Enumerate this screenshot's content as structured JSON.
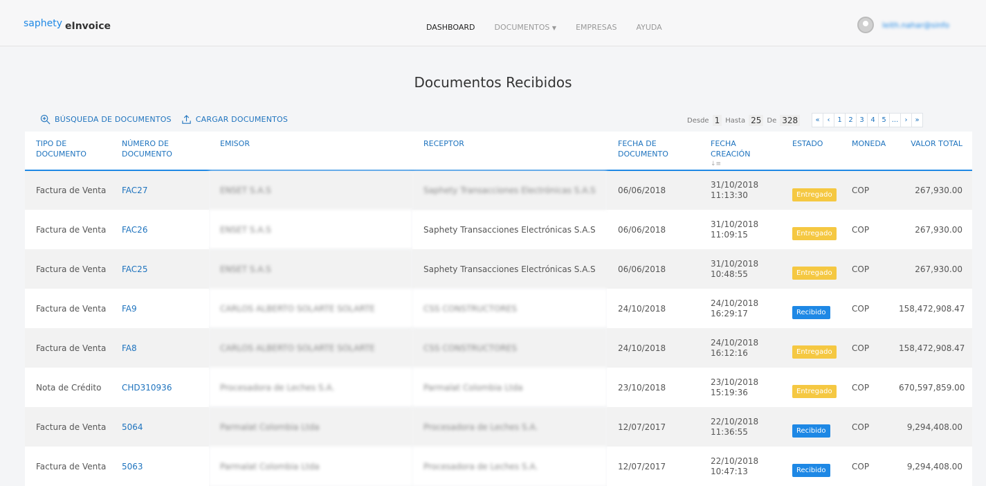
{
  "app": {
    "logo": "saphety",
    "name": "eInvoice"
  },
  "nav": [
    {
      "label": "DASHBOARD",
      "active": true
    },
    {
      "label": "DOCUMENTOS",
      "dropdown": true
    },
    {
      "label": "EMPRESAS"
    },
    {
      "label": "AYUDA"
    }
  ],
  "user": {
    "email": "leith.nahar@sinfo"
  },
  "page": {
    "title": "Documentos Recibidos"
  },
  "toolbar": {
    "search_label": "BÚSQUEDA DE DOCUMENTOS",
    "upload_label": "CARGAR DOCUMENTOS"
  },
  "range": {
    "from_label": "Desde",
    "from": "1",
    "to_label": "Hasta",
    "to": "25",
    "of_label": "De",
    "total": "328"
  },
  "pager": [
    "«",
    "‹",
    "1",
    "2",
    "3",
    "4",
    "5",
    "...",
    "›",
    "»"
  ],
  "table": {
    "headers": {
      "tipo": "TIPO DE DOCUMENTO",
      "numero": "NÚMERO DE DOCUMENTO",
      "emisor": "EMISOR",
      "receptor": "RECEPTOR",
      "fecha_doc": "FECHA DE DOCUMENTO",
      "fecha_creacion": "FECHA CREACIÓN",
      "estado": "ESTADO",
      "moneda": "MONEDA",
      "valor": "VALOR TOTAL"
    },
    "rows": [
      {
        "tipo": "Factura de Venta",
        "numero": "FAC27",
        "emisor": "ENSET S.A.S",
        "receptor": "Saphety Transacciones Electrónicas S.A.S",
        "receptor_blur": true,
        "fecha_doc": "06/06/2018",
        "fecha_creacion_d": "31/10/2018",
        "fecha_creacion_t": "11:13:30",
        "estado": "Entregado",
        "moneda": "COP",
        "valor": "267,930.00"
      },
      {
        "tipo": "Factura de Venta",
        "numero": "FAC26",
        "emisor": "ENSET S.A.S",
        "receptor": "Saphety Transacciones Electrónicas S.A.S",
        "receptor_blur": false,
        "fecha_doc": "06/06/2018",
        "fecha_creacion_d": "31/10/2018",
        "fecha_creacion_t": "11:09:15",
        "estado": "Entregado",
        "moneda": "COP",
        "valor": "267,930.00"
      },
      {
        "tipo": "Factura de Venta",
        "numero": "FAC25",
        "emisor": "ENSET S.A.S",
        "receptor": "Saphety Transacciones Electrónicas S.A.S",
        "receptor_blur": false,
        "fecha_doc": "06/06/2018",
        "fecha_creacion_d": "31/10/2018",
        "fecha_creacion_t": "10:48:55",
        "estado": "Entregado",
        "moneda": "COP",
        "valor": "267,930.00"
      },
      {
        "tipo": "Factura de Venta",
        "numero": "FA9",
        "emisor": "CARLOS ALBERTO SOLARTE SOLARTE",
        "receptor": "CSS CONSTRUCTORES",
        "receptor_blur": true,
        "fecha_doc": "24/10/2018",
        "fecha_creacion_d": "24/10/2018",
        "fecha_creacion_t": "16:29:17",
        "estado": "Recibido",
        "moneda": "COP",
        "valor": "158,472,908.47"
      },
      {
        "tipo": "Factura de Venta",
        "numero": "FA8",
        "emisor": "CARLOS ALBERTO SOLARTE SOLARTE",
        "receptor": "CSS CONSTRUCTORES",
        "receptor_blur": true,
        "fecha_doc": "24/10/2018",
        "fecha_creacion_d": "24/10/2018",
        "fecha_creacion_t": "16:12:16",
        "estado": "Entregado",
        "moneda": "COP",
        "valor": "158,472,908.47"
      },
      {
        "tipo": "Nota de Crédito",
        "numero": "CHD310936",
        "emisor": "Procesadora de Leches S.A.",
        "receptor": "Parmalat Colombia Ltda",
        "receptor_blur": true,
        "fecha_doc": "23/10/2018",
        "fecha_creacion_d": "23/10/2018",
        "fecha_creacion_t": "15:19:36",
        "estado": "Entregado",
        "moneda": "COP",
        "valor": "670,597,859.00"
      },
      {
        "tipo": "Factura de Venta",
        "numero": "5064",
        "emisor": "Parmalat Colombia Ltda",
        "receptor": "Procesadora de Leches S.A.",
        "receptor_blur": true,
        "fecha_doc": "12/07/2017",
        "fecha_creacion_d": "22/10/2018",
        "fecha_creacion_t": "11:36:55",
        "estado": "Recibido",
        "moneda": "COP",
        "valor": "9,294,408.00"
      },
      {
        "tipo": "Factura de Venta",
        "numero": "5063",
        "emisor": "Parmalat Colombia Ltda",
        "receptor": "Procesadora de Leches S.A.",
        "receptor_blur": true,
        "fecha_doc": "12/07/2017",
        "fecha_creacion_d": "22/10/2018",
        "fecha_creacion_t": "10:47:13",
        "estado": "Recibido",
        "moneda": "COP",
        "valor": "9,294,408.00"
      }
    ]
  },
  "colors": {
    "accent": "#1e88e5",
    "link": "#1e73be",
    "entregado": "#f5c842",
    "recibido": "#1e88e5"
  }
}
